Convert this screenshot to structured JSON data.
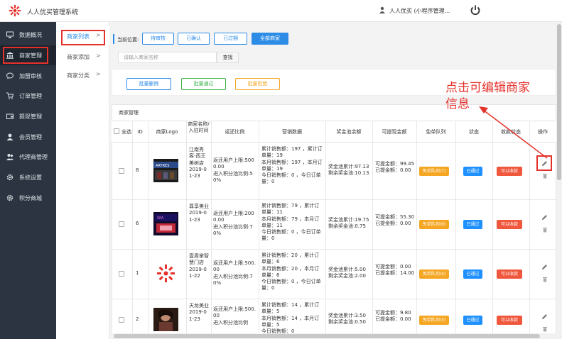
{
  "app": {
    "title": "人人优买管理系统",
    "user": "人人优买 (小程序管理..."
  },
  "sidebar": {
    "items": [
      {
        "label": "数据概况",
        "icon": "monitor-icon"
      },
      {
        "label": "商家管理",
        "icon": "bank-icon",
        "active": true
      },
      {
        "label": "加盟审核",
        "icon": "chat-icon"
      },
      {
        "label": "订单管理",
        "icon": "cart-icon"
      },
      {
        "label": "提现管理",
        "icon": "withdraw-icon"
      },
      {
        "label": "会员管理",
        "icon": "user-icon"
      },
      {
        "label": "代理商管理",
        "icon": "users-icon"
      },
      {
        "label": "系统设置",
        "icon": "gear-icon"
      },
      {
        "label": "积分商城",
        "icon": "gear-icon"
      }
    ]
  },
  "subnav": {
    "items": [
      {
        "label": "商家列表",
        "arrow": ">",
        "active": true
      },
      {
        "label": "商家添加",
        "arrow": ">"
      },
      {
        "label": "商家分类",
        "arrow": ">"
      }
    ]
  },
  "filters": {
    "crumb": "当前位置:",
    "buttons": [
      "待审核",
      "已确认",
      "已过期",
      "全部商家"
    ]
  },
  "search": {
    "placeholder": "请输入商家名称",
    "button": "查找"
  },
  "actions": {
    "delete": "批量删除",
    "approve": "批量通过",
    "reject": "批量拒绝"
  },
  "colors": {
    "accent": "#2c8ce6",
    "danger": "#e5312b",
    "green": "#3bb54a",
    "orange": "#f5a623",
    "queue": "#f5a623",
    "status_blue": "#1e90ff",
    "withdraw_red": "#f0583e"
  },
  "table": {
    "title": "商家管理",
    "headers": {
      "select": "全选",
      "id": "ID",
      "logo": "商家Logo",
      "name": "商家名称/入驻时间",
      "rebate": "返还比例",
      "sales": "营销数据",
      "reward": "奖金池余额",
      "cash": "可提现金额",
      "queue": "免单队列",
      "status": "状态",
      "collect": "收款状态",
      "ops": "操作"
    },
    "rows": [
      {
        "id": "8",
        "name": "江南秀客-西王美树店\n2019-01-23",
        "rebate": "返还用户上限:5000.00\n进入积分池比例:50%",
        "sales": "累计销售额：197 ，累计订单量：19\n本月销售额：197 ，本月订单量：19\n今日销售额：0 ，今日订单量：0",
        "reward": "奖金池累计:97.13\n剩余奖金池:10.13",
        "cash": "可提金额：99.45\n已提金额：0.00",
        "queue": "免单队列(7)",
        "status": "已通过",
        "collect": "可以收款"
      },
      {
        "id": "6",
        "name": "尊享美业\n2019-01-23",
        "rebate": "返还用户上限:2000.00\n进入积分池比例:70%",
        "sales": "累计销售额：79 ，累计订单量：11\n本月销售额：79 ，本月订单量：11\n今日销售额：0 ，今日订单量：0",
        "reward": "奖金池累计:19.75\n剩余奖金池:0.75",
        "cash": "可提金额：55.30\n已提金额：0.00",
        "queue": "免单队列(6)",
        "status": "已通过",
        "collect": "可以收款"
      },
      {
        "id": "1",
        "name": "壹周掌智慧门店\n2019-01-22",
        "rebate": "返还用户上限:500.00\n进入积分池比例:70%",
        "sales": "累计销售额：20 ，累计订单量：6\n本月销售额：20 ，本月订单量：6\n今日销售额：0 ，今日订单量：0",
        "reward": "奖金池累计:5.00\n剩余奖金池:2.00",
        "cash": "可提金额：0.00\n已提金额：14.00",
        "queue": "免单队列(4)",
        "status": "已通过",
        "collect": "可以收款"
      },
      {
        "id": "2",
        "name": "天龙美业\n2019-01-23",
        "rebate": "返还用户上限:500.00\n进入积分池比例",
        "sales": "累计销售额：14 ，累计订单量：5\n本月销售额：14 ，本月订单量：5\n今日销售额：0",
        "reward": "奖金池累计:3.50\n剩余奖金池:0.50",
        "cash": "可提金额：9.80\n已提金额：0.00",
        "queue": "免单队列(3)",
        "status": "已通过",
        "collect": "可以收款"
      }
    ]
  },
  "annotation": "点击可编辑商家\n信息"
}
